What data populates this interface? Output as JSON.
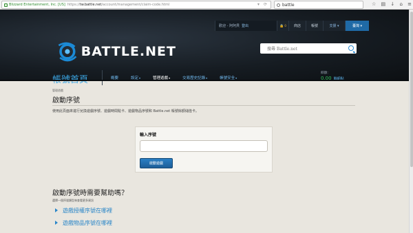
{
  "browser": {
    "org": "Blizzard Entertainment, Inc. [US]",
    "url_prefix": "https://",
    "url_main": "tw.battle.net",
    "url_rest": "/account/management/claim-code.html",
    "search_text": "battle"
  },
  "topnav": {
    "account_label": "歡迎 - 阿阿貝",
    "logout": "登出",
    "mail_count": "0",
    "link1": "商店",
    "link2": "帳號",
    "lang": "支援 ▾",
    "shop": "臺灣 ▾"
  },
  "logo_text": "BATTLE.NET",
  "header_search": {
    "placeholder": "搜尋 Battle.net"
  },
  "page_title": "帳號首頁",
  "mainnav": [
    {
      "label": "概要",
      "caret": ""
    },
    {
      "label": "設定",
      "caret": "▾"
    },
    {
      "label": "管理遊戲",
      "caret": "▾"
    },
    {
      "label": "交易歷史記錄",
      "caret": "▾"
    },
    {
      "label": "帳號安全",
      "caret": "▾"
    }
  ],
  "balance": {
    "label": "餘額：",
    "amount": "0.00",
    "add": "戰網點"
  },
  "content": {
    "breadcrumb": "管理遊戲",
    "heading": "啟動序號",
    "description": "使用此頁面來進行兌換遊戲序號、遊戲時間點卡、遊戲物品序號和 Battle.net 帳號餘額儲值卡。",
    "input_label": "輸入序號",
    "submit": "啟動遊戲",
    "help_title": "啟動序號時需要幫助嗎？",
    "help_sub": "選擇一個序號類型來查看更多資訊",
    "help_links": [
      "遊戲授權序號在哪裡",
      "遊戲物品序號在哪裡"
    ]
  }
}
